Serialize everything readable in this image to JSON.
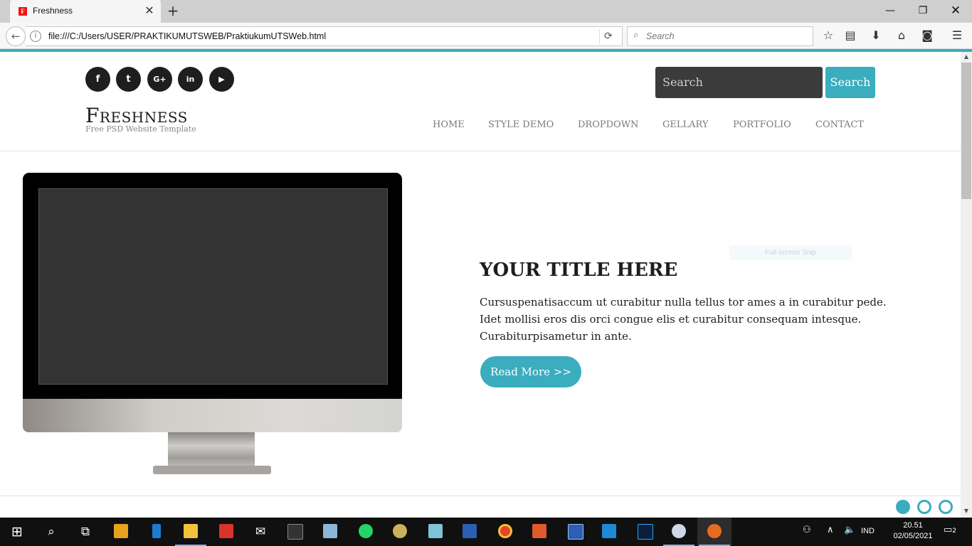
{
  "browser": {
    "tab_title": "Freshness",
    "favicon_letter": "F",
    "url": "file:///C:/Users/USER/PRAKTIKUMUTSWEB/PraktiukumUTSWeb.html",
    "search_placeholder": "Search",
    "icons": [
      "back-arrow-icon",
      "info-icon",
      "reload-icon",
      "search-icon",
      "star-icon",
      "reading-list-icon",
      "download-icon",
      "home-icon",
      "pocket-icon",
      "menu-icon"
    ]
  },
  "page": {
    "social": [
      {
        "name": "facebook",
        "glyph": "f"
      },
      {
        "name": "twitter",
        "glyph": "t"
      },
      {
        "name": "google-plus",
        "glyph": "G+"
      },
      {
        "name": "linkedin",
        "glyph": "in"
      },
      {
        "name": "youtube",
        "glyph": "▶"
      }
    ],
    "search": {
      "placeholder": "Search",
      "button": "Search"
    },
    "logo": {
      "title": "Freshness",
      "tagline": "Free PSD Website Template"
    },
    "nav": [
      "HOME",
      "STYLE DEMO",
      "DROPDOWN",
      "GELLARY",
      "PORTFOLIO",
      "CONTACT"
    ],
    "hero": {
      "title": "YOUR TITLE HERE",
      "text": "Cursuspenatisaccum ut curabitur nulla tellus tor ames a in curabitur pede. Idet mollisi eros dis orci congue elis et curabitur consequam intesque. Curabiturpisametur in ante.",
      "button": "Read More >>"
    },
    "snip_label": "Full-screen Snip",
    "slider_dots": 3,
    "active_dot": 1,
    "accent_color": "#3aadbe"
  },
  "taskbar": {
    "language": "IND",
    "time": "20.51",
    "date": "02/05/2021",
    "notifications": "2"
  }
}
